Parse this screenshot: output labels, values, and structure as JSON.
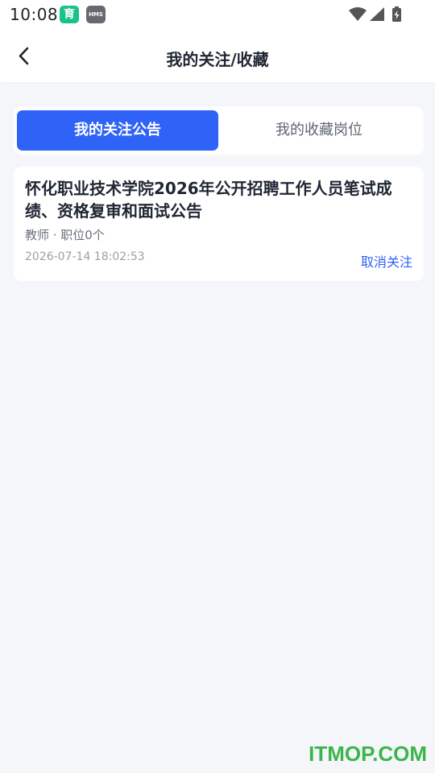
{
  "status_bar": {
    "time": "10:08",
    "app_icon_1": "育",
    "app_icon_2": "HMS",
    "icons": [
      "wifi-icon",
      "signal-icon",
      "battery-charging-icon"
    ]
  },
  "header": {
    "back_icon": "chevron-left-icon",
    "title": "我的关注/收藏"
  },
  "tabs": [
    {
      "label": "我的关注公告",
      "active": true
    },
    {
      "label": "我的收藏岗位",
      "active": false
    }
  ],
  "announcements": [
    {
      "title": "怀化职业技术学院2026年公开招聘工作人员笔试成绩、资格复审和面试公告",
      "meta": "教师 · 职位0个",
      "datetime": "2026-07-14 18:02:53",
      "action_label": "取消关注"
    }
  ],
  "watermark": "ITMOP.COM",
  "colors": {
    "accent": "#2f62f6",
    "background": "#f4f6fa",
    "watermark": "#3bb54a"
  }
}
